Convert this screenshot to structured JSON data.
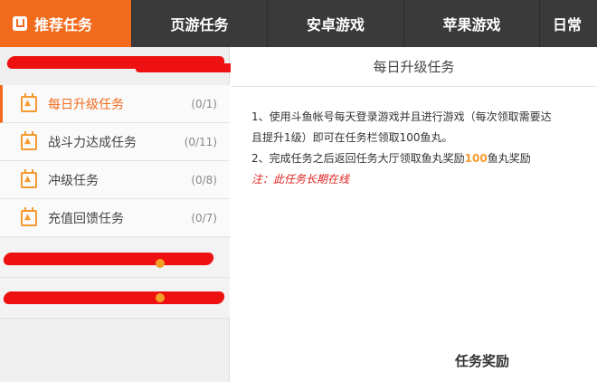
{
  "nav": {
    "tabs": [
      {
        "label": "推荐任务",
        "active": true
      },
      {
        "label": "页游任务"
      },
      {
        "label": "安卓游戏"
      },
      {
        "label": "苹果游戏"
      },
      {
        "label": "日常"
      }
    ]
  },
  "sidebar": {
    "items": [
      {
        "label": "每日升级任务",
        "count": "(0/1)",
        "active": true
      },
      {
        "label": "战斗力达成任务",
        "count": "(0/11)"
      },
      {
        "label": "冲级任务",
        "count": "(0/8)"
      },
      {
        "label": "充值回馈任务",
        "count": "(0/7)"
      }
    ]
  },
  "main": {
    "title": "每日升级任务",
    "desc": {
      "line1": "1、使用斗鱼帐号每天登录游戏并且进行游戏（每次领取需要达",
      "line2": "且提升1级）即可在任务栏领取100鱼丸。",
      "line3_pre": "2、完成任务之后返回任务大厅领取鱼丸奖励",
      "line3_hl": "100",
      "line3_post": "鱼丸奖励",
      "note": "注：此任务长期在线"
    },
    "reward_title": "任务奖励"
  },
  "colors": {
    "accent": "#f26b1d",
    "nav_bg": "#3a3a3a",
    "highlight": "#f39a2f",
    "note_red": "#e02020"
  }
}
